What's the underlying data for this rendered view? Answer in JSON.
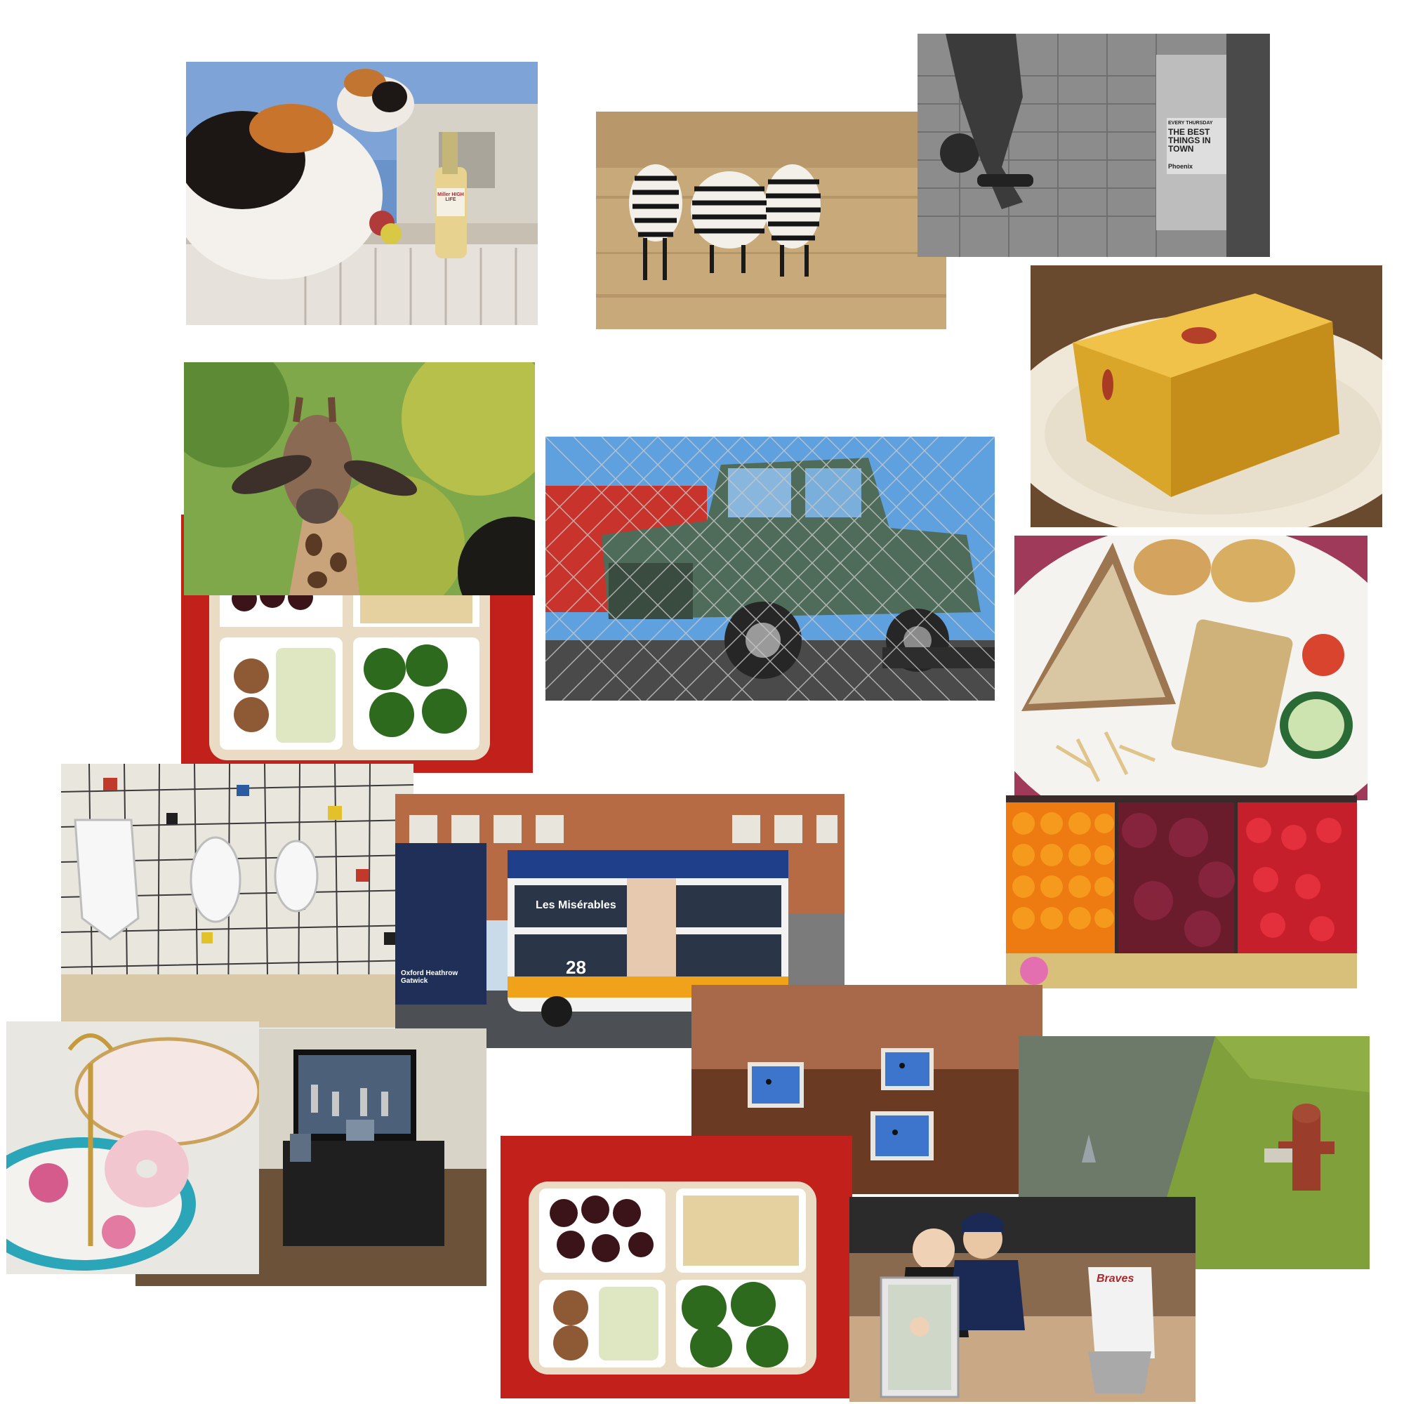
{
  "collage": {
    "photos": [
      {
        "id": "cat-beer",
        "subject": "calico cat on wall next to beer bottle"
      },
      {
        "id": "zebras",
        "subject": "three zebras in dry grass"
      },
      {
        "id": "skateboarder",
        "subject": "skateboarder on brick sidewalk (black and white)"
      },
      {
        "id": "jelly",
        "subject": "jelly dessert on plate"
      },
      {
        "id": "giraffe",
        "subject": "giraffe head with trees"
      },
      {
        "id": "truck",
        "subject": "old green truck behind chain-link fence"
      },
      {
        "id": "sandwich",
        "subject": "sandwich plate with bread"
      },
      {
        "id": "bento-top",
        "subject": "bento box with grapes, cheese, broccoli"
      },
      {
        "id": "urinals",
        "subject": "mosaic tiled restroom with urinals"
      },
      {
        "id": "bus",
        "subject": "double-decker bus"
      },
      {
        "id": "fruit",
        "subject": "oranges, grapes and strawberries at market"
      },
      {
        "id": "donut",
        "subject": "donut on cake stand with teacups"
      },
      {
        "id": "tv",
        "subject": "living room with television"
      },
      {
        "id": "laptops",
        "subject": "laptops on bed"
      },
      {
        "id": "hydrant",
        "subject": "fire hydrant by pond with heron"
      },
      {
        "id": "bento-bottom",
        "subject": "bento box on red cloth"
      },
      {
        "id": "baseball",
        "subject": "kids playing baseball"
      }
    ],
    "visible_text": {
      "skate_sign_top": "EVERY THURSDAY",
      "skate_sign_main": "THE BEST THINGS IN TOWN",
      "skate_sign_brand": "Phoenix",
      "bus_route": "28",
      "bus_ad": "Les Misérables",
      "coach_text": "Oxford Heathrow Gatwick",
      "beer_label": "Miller HIGH LIFE",
      "jersey": "Braves"
    }
  }
}
